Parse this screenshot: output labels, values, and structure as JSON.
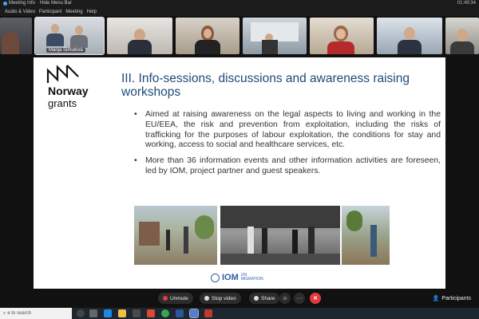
{
  "topbar": {
    "meeting_info": "Meeting Info",
    "hide_menu": "Hide Menu Bar",
    "time": "01:49:34"
  },
  "menu": [
    "Audio & Video",
    "Participant",
    "Meeting",
    "Help"
  ],
  "participants_strip": {
    "active_name": "Marija Šimulová"
  },
  "slide": {
    "logo": {
      "line1": "Norway",
      "line2": "grants"
    },
    "title": "III. Info-sessions, discussions and awareness raising workshops",
    "bullets": [
      "Aimed at raising awareness on the legal aspects to living and working in the EU/EEA, the risk and prevention from exploitation, including the risks of trafficking for the purposes of labour exploitation, the conditions for stay and working, access to social and healthcare services, etc.",
      "More than 36 information events and other information activities are foreseen, led by IOM, project partner and guest speakers."
    ],
    "iom": {
      "name": "IOM",
      "un": "UN",
      "migration": "MIGRATION"
    }
  },
  "controls": {
    "unmute": "Unmute",
    "stop_video": "Stop video",
    "share": "Share",
    "more": "···",
    "end": "✕",
    "participants": "Participants"
  },
  "taskbar": {
    "search_placeholder": "e to search"
  },
  "colors": {
    "title_blue": "#1f4a7a",
    "iom_blue": "#2a5ea8",
    "end_red": "#e23b3b"
  }
}
